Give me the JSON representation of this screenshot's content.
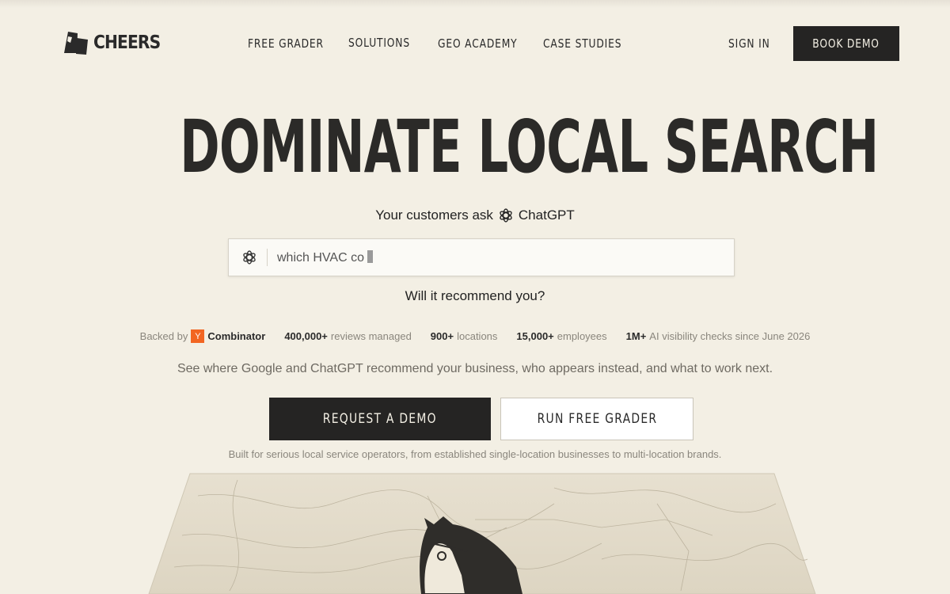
{
  "brand": {
    "name": "CHEERS"
  },
  "nav": {
    "items": [
      "FREE GRADER",
      "SOLUTIONS",
      "GEO ACADEMY",
      "CASE STUDIES"
    ],
    "sign_in": "SIGN IN",
    "book_demo": "BOOK DEMO"
  },
  "hero": {
    "title": "DOMINATE LOCAL SEARCH",
    "ask_prefix": "Your customers ask",
    "ask_brand": "ChatGPT",
    "search_typed": "which HVAC co",
    "question": "Will it recommend you?"
  },
  "stats": {
    "backed_by": "Backed by",
    "yc_letter": "Y",
    "yc_name": "Combinator",
    "reviews_num": "400,000+",
    "reviews_label": "reviews managed",
    "locations_num": "900+",
    "locations_label": "locations",
    "employees_num": "15,000+",
    "employees_label": "employees",
    "checks_num": "1M+",
    "checks_label": "AI visibility checks since June 2026"
  },
  "subheadline": "See where Google and ChatGPT recommend your business, who appears instead, and what to work next.",
  "cta": {
    "primary": "REQUEST A DEMO",
    "secondary": "RUN FREE GRADER",
    "note": "Built for serious local service operators, from established single-location businesses to multi-location brands."
  },
  "colors": {
    "background": "#f3efe4",
    "dark": "#252423",
    "yc_orange": "#f26522"
  }
}
